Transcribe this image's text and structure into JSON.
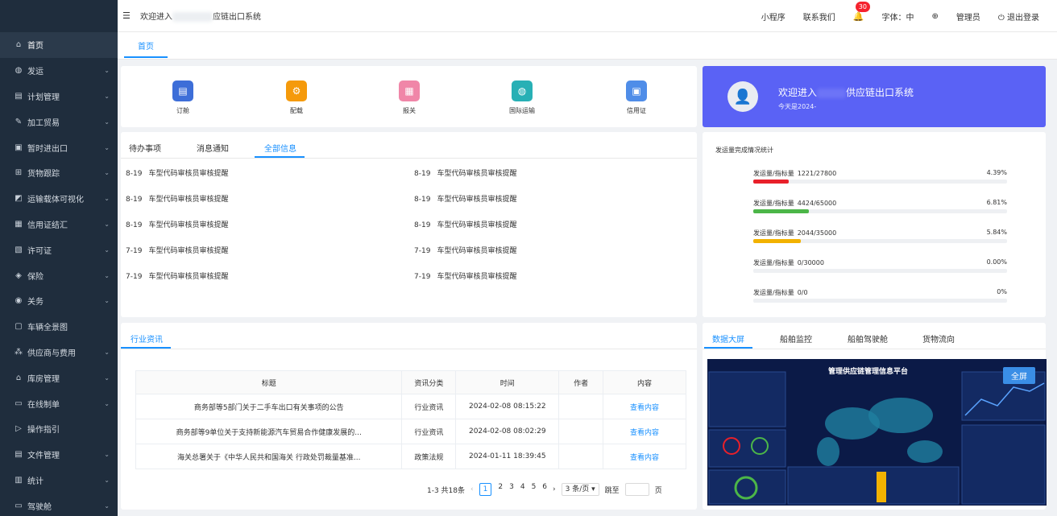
{
  "header": {
    "welcome": "欢迎进入",
    "welcome_suffix": "应链出口系统",
    "mini_program": "小程序",
    "contact": "联系我们",
    "notifications": "30",
    "font_size": "字体：中",
    "user": "管理员",
    "logout": "退出登录"
  },
  "sidebar": {
    "items": [
      {
        "label": "首页",
        "icon": "home-icon"
      },
      {
        "label": "发运",
        "icon": "globe-icon"
      },
      {
        "label": "计划管理",
        "icon": "plan-icon"
      },
      {
        "label": "加工贸易",
        "icon": "tool-icon"
      },
      {
        "label": "暂时进出口",
        "icon": "truck-icon"
      },
      {
        "label": "货物跟踪",
        "icon": "tracking-icon"
      },
      {
        "label": "运输载体可视化",
        "icon": "chart-icon"
      },
      {
        "label": "信用证结汇",
        "icon": "credit-icon"
      },
      {
        "label": "许可证",
        "icon": "license-icon"
      },
      {
        "label": "保险",
        "icon": "shield-icon"
      },
      {
        "label": "关务",
        "icon": "eye-icon"
      },
      {
        "label": "车辆全景图",
        "icon": "panorama-icon"
      },
      {
        "label": "供应商与费用",
        "icon": "supplier-icon"
      },
      {
        "label": "库房管理",
        "icon": "warehouse-icon"
      },
      {
        "label": "在线制单",
        "icon": "form-icon"
      },
      {
        "label": "操作指引",
        "icon": "guide-icon"
      },
      {
        "label": "文件管理",
        "icon": "file-icon"
      },
      {
        "label": "统计",
        "icon": "stats-icon"
      },
      {
        "label": "驾驶舱",
        "icon": "cockpit-icon"
      }
    ]
  },
  "tabs": {
    "home": "首页"
  },
  "shortcuts": [
    {
      "label": "订舱",
      "color": "#3d6ed8"
    },
    {
      "label": "配载",
      "color": "#f59a0b"
    },
    {
      "label": "报关",
      "color": "#f086a8"
    },
    {
      "label": "国际运输",
      "color": "#28b0b5"
    },
    {
      "label": "信用证",
      "color": "#4f8de8"
    }
  ],
  "banner": {
    "title_prefix": "欢迎进入",
    "title_suffix": "供应链出口系统",
    "subtitle": "今天是2024-"
  },
  "messages": {
    "tabs": [
      "待办事项",
      "消息通知",
      "全部信息"
    ],
    "active_tab": 2,
    "items": [
      {
        "date": "8-19",
        "text": "车型代码审核员审核提醒"
      },
      {
        "date": "8-19",
        "text": "车型代码审核员审核提醒"
      },
      {
        "date": "8-19",
        "text": "车型代码审核员审核提醒"
      },
      {
        "date": "8-19",
        "text": "车型代码审核员审核提醒"
      },
      {
        "date": "8-19",
        "text": "车型代码审核员审核提醒"
      },
      {
        "date": "8-19",
        "text": "车型代码审核员审核提醒"
      },
      {
        "date": "7-19",
        "text": "车型代码审核员审核提醒"
      },
      {
        "date": "7-19",
        "text": "车型代码审核员审核提醒"
      },
      {
        "date": "7-19",
        "text": "车型代码审核员审核提醒"
      },
      {
        "date": "7-19",
        "text": "车型代码审核员审核提醒"
      }
    ]
  },
  "stats": {
    "title": "发运量完成情况统计",
    "rows": [
      {
        "label": "发运量/指标量",
        "value": "1221/27800",
        "pct": "4.39%",
        "fraction": 0.0439,
        "color": "#e8202a"
      },
      {
        "label": "发运量/指标量",
        "value": "4424/65000",
        "pct": "6.81%",
        "fraction": 0.0681,
        "color": "#4cb648"
      },
      {
        "label": "发运量/指标量",
        "value": "2044/35000",
        "pct": "5.84%",
        "fraction": 0.0584,
        "color": "#f2b200"
      },
      {
        "label": "发运量/指标量",
        "value": "0/30000",
        "pct": "0.00%",
        "fraction": 0,
        "color": "#e8202a"
      },
      {
        "label": "发运量/指标量",
        "value": "0/0",
        "pct": "0%",
        "fraction": 0,
        "color": "#e8202a"
      }
    ]
  },
  "news": {
    "tab": "行业资讯",
    "columns": [
      "标题",
      "资讯分类",
      "时间",
      "作者",
      "内容"
    ],
    "rows": [
      {
        "title": "商务部等5部门关于二手车出口有关事项的公告",
        "category": "行业资讯",
        "time": "2024-02-08 08:15:22",
        "author": "",
        "action": "查看内容"
      },
      {
        "title": "商务部等9单位关于支持新能源汽车贸易合作健康发展的...",
        "category": "行业资讯",
        "time": "2024-02-08 08:02:29",
        "author": "",
        "action": "查看内容"
      },
      {
        "title": "海关总署关于《中华人民共和国海关 行政处罚裁量基准...",
        "category": "政策法规",
        "time": "2024-01-11 18:39:45",
        "author": "",
        "action": "查看内容"
      }
    ],
    "pager": {
      "summary": "1-3 共18条",
      "pages": [
        "1",
        "2",
        "3",
        "4",
        "5",
        "6"
      ],
      "page_size": "3 条/页",
      "jump_label": "跳至",
      "page_suffix": "页"
    }
  },
  "dashboard": {
    "tabs": [
      "数据大屏",
      "船舶监控",
      "船舶驾驶舱",
      "货物流向"
    ],
    "active_tab": 0,
    "title": "管理供应链管理信息平台",
    "fullscreen": "全屏"
  }
}
